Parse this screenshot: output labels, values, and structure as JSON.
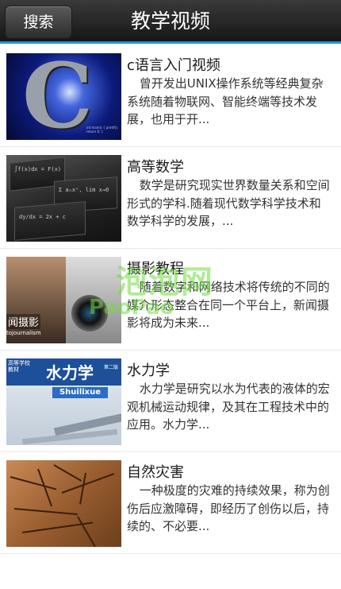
{
  "header": {
    "search_label": "搜索",
    "title": "教学视频",
    "accent_color": "#2a8fd6"
  },
  "items": [
    {
      "title": "c语言入门视频",
      "description": "曾开发出UNIX操作系统等经典复杂系统随着物联网、智能终端等技术发展，也用于开..."
    },
    {
      "title": "高等数学",
      "description": "数学是研究现实世界数量关系和空间形式的学科.随着现代数学科学技术和数学科学的发展，..."
    },
    {
      "title": "摄影教程",
      "description": "随着数字和网络技术将传统的不同的媒介形态整合在同一个平台上，新闻摄影将成为未来..."
    },
    {
      "title": "水力学",
      "description": "水力学是研究以水为代表的液体的宏观机械运动规律，及其在工程技术中的应用。水力学..."
    },
    {
      "title": "自然灾害",
      "description": "一种极度的灾难的持续效果，称为创伤后应激障碍，即经历了创伤以后，持续的、不必要..."
    }
  ],
  "thumbnails": {
    "t1_letter": "C",
    "t3_label": "闻摄影",
    "t3_sublabel": "tojournalism",
    "t4_publisher": "高等学校\n教材",
    "t4_title": "水力学",
    "t4_pinyin": "Shuilixue",
    "t4_tag": "第二版"
  },
  "watermark": {
    "line1": "泡泡网",
    "line2": "PaoPao"
  }
}
